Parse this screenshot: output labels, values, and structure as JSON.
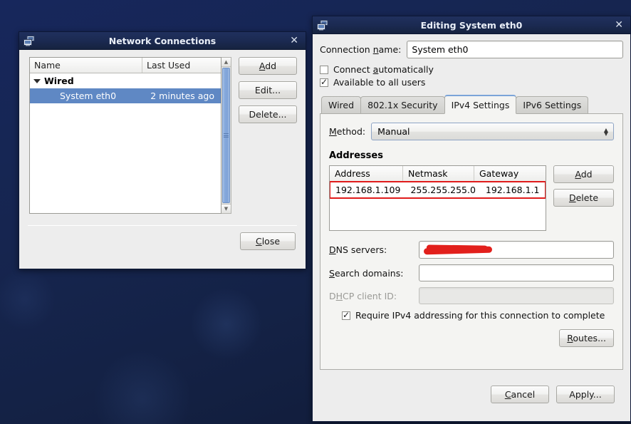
{
  "network_connections": {
    "title": "Network Connections",
    "icon": "network-computers-icon",
    "close_label": "✕",
    "columns": {
      "name": "Name",
      "last_used": "Last Used"
    },
    "groups": [
      {
        "label": "Wired",
        "expanded": true,
        "rows": [
          {
            "name": "System eth0",
            "last_used": "2 minutes ago",
            "selected": true
          }
        ]
      }
    ],
    "buttons": {
      "add": "Add",
      "add_mnemonic": "A",
      "edit": "Edit...",
      "delete": "Delete...",
      "close": "Close",
      "close_mnemonic": "C"
    }
  },
  "editing_dialog": {
    "title": "Editing System eth0",
    "icon": "network-computers-icon",
    "close_label": "✕",
    "connection_name": {
      "label_pre": "Connection ",
      "label_mnemonic": "n",
      "label_post": "ame:",
      "value": "System eth0"
    },
    "checkboxes": [
      {
        "label_pre": "Connect ",
        "mnemonic": "a",
        "label_post": "utomatically",
        "checked": false
      },
      {
        "label_pre": "Available to all users",
        "mnemonic": "",
        "label_post": "",
        "checked": true
      }
    ],
    "tabs": [
      {
        "label": "Wired",
        "active": false
      },
      {
        "label": "802.1x Security",
        "active": false
      },
      {
        "label": "IPv4 Settings",
        "active": true
      },
      {
        "label": "IPv6 Settings",
        "active": false
      }
    ],
    "method": {
      "label_pre": "",
      "mnemonic": "M",
      "label_post": "ethod:",
      "value": "Manual"
    },
    "addresses": {
      "section_title": "Addresses",
      "columns": [
        "Address",
        "Netmask",
        "Gateway"
      ],
      "rows": [
        {
          "address": "192.168.1.109",
          "netmask": "255.255.255.0",
          "gateway": "192.168.1.1",
          "highlighted": true
        }
      ],
      "add_pre": "",
      "add_mnemonic": "A",
      "add_post": "dd",
      "delete_pre": "",
      "delete_mnemonic": "D",
      "delete_post": "elete"
    },
    "dns_servers": {
      "label_pre": "",
      "mnemonic": "D",
      "label_post": "NS servers:",
      "value": "",
      "redacted": true
    },
    "search_domains": {
      "label_pre": "",
      "mnemonic": "S",
      "label_post": "earch domains:",
      "value": ""
    },
    "dhcp_client_id": {
      "label_pre": "D",
      "mnemonic": "H",
      "label_post": "CP client ID:",
      "value": "",
      "disabled": true
    },
    "require_ipv4": {
      "label": "Require IPv4 addressing for this connection to complete",
      "checked": true
    },
    "routes": {
      "label_pre": "",
      "mnemonic": "R",
      "label_post": "outes..."
    },
    "footer": {
      "cancel_pre": "",
      "cancel_mnemonic": "C",
      "cancel_post": "ancel",
      "apply": "Apply..."
    }
  },
  "colors": {
    "titlebar": "#1b2a52",
    "selection": "#5f88c4",
    "redaction": "#e2201c",
    "desktop": "#16254f",
    "tab_active_top": "#7ba4d9"
  }
}
